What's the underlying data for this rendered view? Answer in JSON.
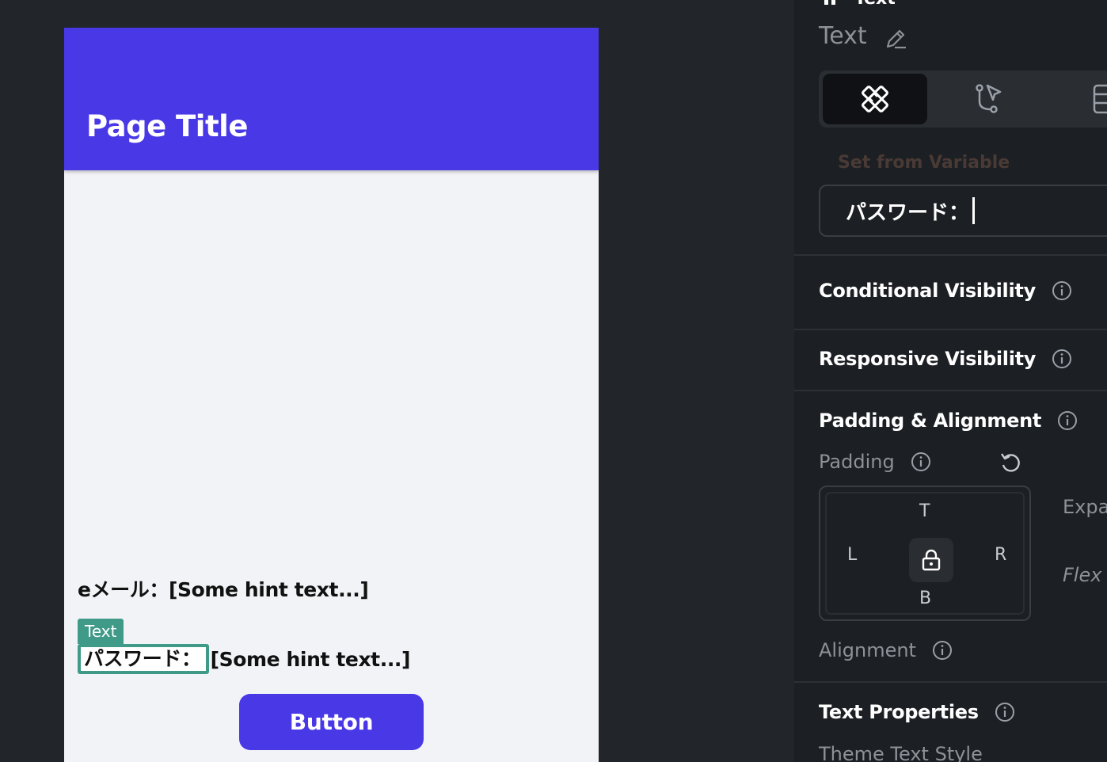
{
  "phone": {
    "page_title": "Page Title",
    "email_row": "eメール：[Some hint text...]",
    "selection_tag": "Text",
    "password_label": "パスワード：",
    "password_hint": "[Some hint text...]",
    "button_label": "Button"
  },
  "panel": {
    "header_label": "Text",
    "widget_name": "Text",
    "tabs": [
      "properties-tab",
      "actions-tab",
      "backend-query-tab"
    ],
    "set_from_variable": "Set from Variable",
    "text_value": "パスワード：",
    "sections": {
      "conditional_visibility": "Conditional Visibility",
      "responsive_visibility": "Responsive Visibility",
      "padding_alignment": "Padding & Alignment",
      "padding": "Padding",
      "alignment": "Alignment",
      "text_properties": "Text Properties",
      "theme_text_style": "Theme Text Style"
    },
    "padding_letters": {
      "t": "T",
      "l": "L",
      "r": "R",
      "b": "B"
    },
    "expand_label": "Expa",
    "flex_label": "Flex"
  },
  "colors": {
    "accent": "#4838e6",
    "selection": "#3f9a88",
    "panel_bg": "#1c1f23",
    "canvas_bg": "#22262b"
  }
}
